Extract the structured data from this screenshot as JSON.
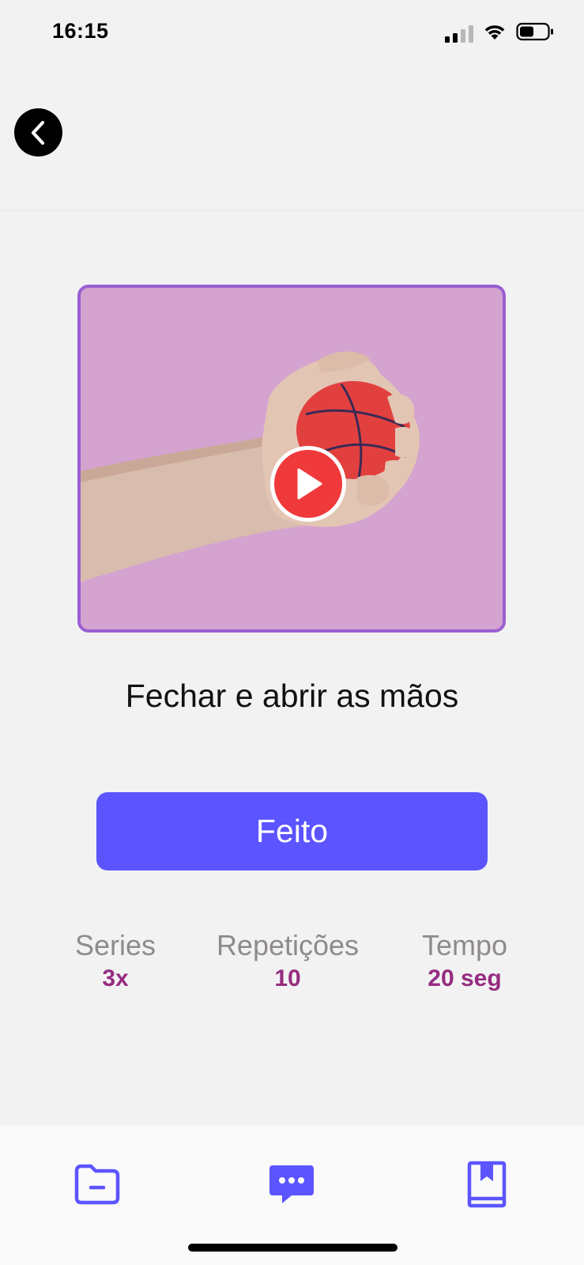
{
  "status_bar": {
    "time": "16:15"
  },
  "header": {
    "back_icon": "chevron-left-icon"
  },
  "video": {
    "play_icon": "play-icon"
  },
  "exercise": {
    "title": "Fechar e abrir as mãos"
  },
  "done_button": {
    "label": "Feito"
  },
  "stats": [
    {
      "label": "Series",
      "value": "3x"
    },
    {
      "label": "Repetições",
      "value": "10"
    },
    {
      "label": "Tempo",
      "value": "20 seg"
    }
  ],
  "bottom_nav": {
    "items": [
      {
        "icon": "folder-icon"
      },
      {
        "icon": "chat-bubble-icon"
      },
      {
        "icon": "bookmark-book-icon"
      }
    ]
  },
  "colors": {
    "accent": "#5b54ff",
    "stat_value": "#962c80",
    "video_background": "#d4a3cf",
    "video_border": "#9a5fd1",
    "play_button": "#f0393a"
  }
}
